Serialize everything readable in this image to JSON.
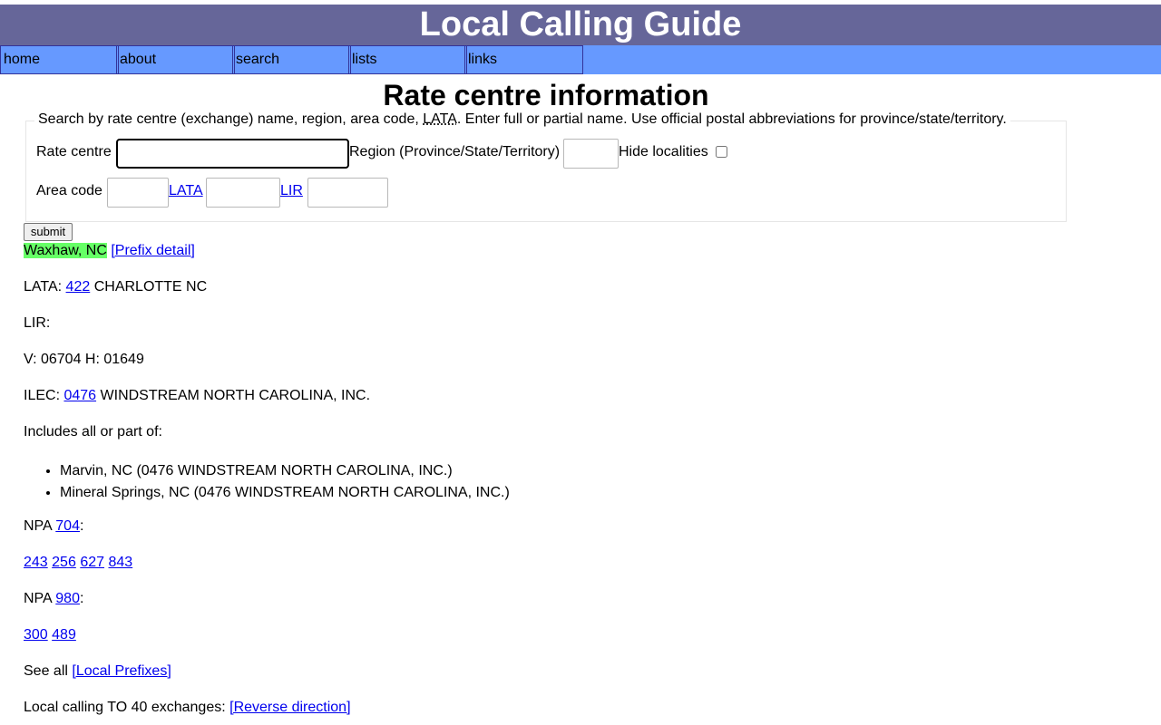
{
  "header": {
    "title": "Local Calling Guide"
  },
  "nav": [
    {
      "label": "home"
    },
    {
      "label": "about"
    },
    {
      "label": "search"
    },
    {
      "label": "lists"
    },
    {
      "label": "links"
    }
  ],
  "page_title": "Rate centre information",
  "search": {
    "legend_before": "Search by rate centre (exchange) name, region, area code, ",
    "legend_abbr": "LATA",
    "legend_after": ". Enter full or partial name. Use official postal abbreviations for province/state/territory.",
    "rate_centre_label": "Rate centre",
    "rate_centre_value": "",
    "region_label": "Region (Province/State/Territory)",
    "region_value": "",
    "hide_localities_label": "Hide localities",
    "hide_localities_checked": false,
    "area_code_label": "Area code",
    "area_code_value": "",
    "lata_label": "LATA",
    "lata_value": "",
    "lir_label": "LIR",
    "lir_value": "",
    "submit_label": "submit"
  },
  "result": {
    "name": "Waxhaw, NC",
    "prefix_detail_link": "[Prefix detail]",
    "lata_label": "LATA:",
    "lata_code": "422",
    "lata_name": "CHARLOTTE NC",
    "lir_label": "LIR:",
    "vh": "V: 06704 H: 01649",
    "ilec_label": "ILEC:",
    "ilec_code": "0476",
    "ilec_name": "WINDSTREAM NORTH CAROLINA, INC.",
    "includes_label": "Includes all or part of:",
    "includes": [
      "Marvin, NC (0476 WINDSTREAM NORTH CAROLINA, INC.)",
      "Mineral Springs, NC (0476 WINDSTREAM NORTH CAROLINA, INC.)"
    ],
    "npa_groups": [
      {
        "label": "NPA",
        "npa": "704",
        "prefixes": [
          "243",
          "256",
          "627",
          "843"
        ]
      },
      {
        "label": "NPA",
        "npa": "980",
        "prefixes": [
          "300",
          "489"
        ]
      }
    ],
    "see_all_label": "See all",
    "local_prefixes_link": "[Local Prefixes]",
    "local_calling_text": "Local calling TO 40 exchanges:",
    "reverse_direction_link": "[Reverse direction]"
  }
}
